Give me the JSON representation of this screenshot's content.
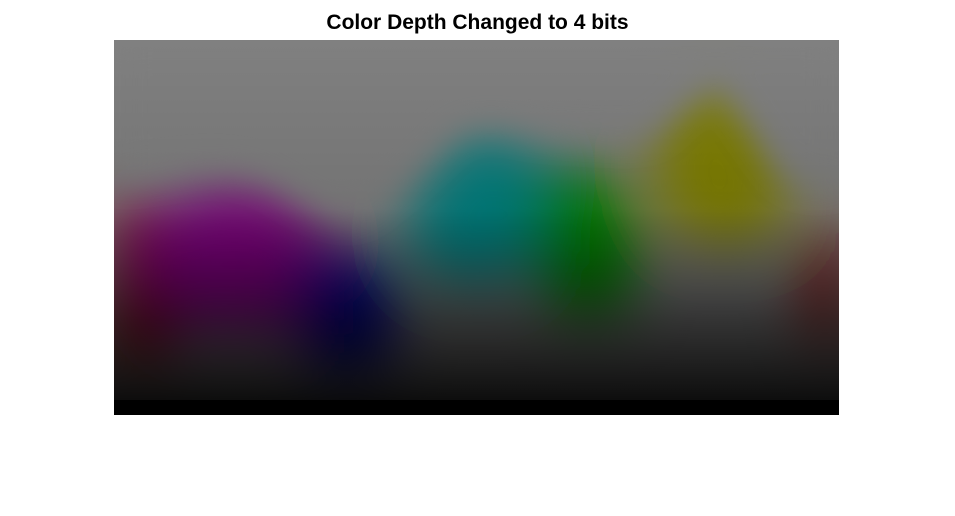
{
  "figure": {
    "title": "Color Depth Changed to 4 bits"
  },
  "image": {
    "background_color": "#808080",
    "top_color": "#808080",
    "bottom_color": "#000000",
    "hues": [
      {
        "name": "red",
        "color": "#8b0000"
      },
      {
        "name": "magenta",
        "color": "#800080"
      },
      {
        "name": "blue",
        "color": "#00008b"
      },
      {
        "name": "teal",
        "color": "#008080"
      },
      {
        "name": "green",
        "color": "#008000"
      },
      {
        "name": "olive",
        "color": "#808000"
      }
    ]
  }
}
